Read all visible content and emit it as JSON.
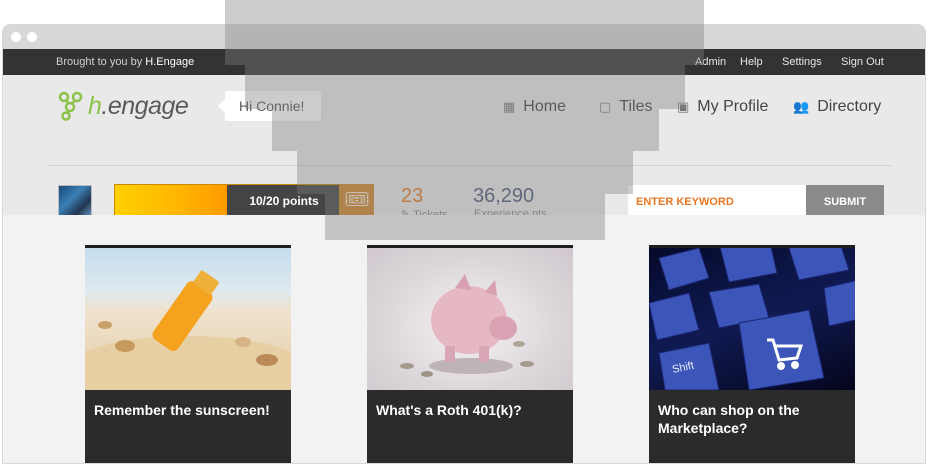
{
  "topbar": {
    "brought_prefix": "Brought to you by ",
    "brought_brand": "H.Engage",
    "links": [
      "Admin",
      "Help",
      "Settings",
      "Sign Out"
    ]
  },
  "header": {
    "logo_text_h": "h",
    "logo_text_rest": ".engage",
    "greeting": "Hi Connie!",
    "nav": [
      {
        "label": "Home",
        "icon": "grid-icon"
      },
      {
        "label": "Tiles",
        "icon": "tiles-icon"
      },
      {
        "label": "My Profile",
        "icon": "profile-card-icon"
      },
      {
        "label": "Directory",
        "icon": "people-icon"
      }
    ]
  },
  "stats": {
    "progress_label": "10/20 points",
    "progress_fraction": 0.5,
    "tickets_value": "23",
    "tickets_label": "Tickets",
    "experience_value": "36,290",
    "experience_label": "Experience pts"
  },
  "search": {
    "placeholder": "ENTER KEYWORD",
    "submit_label": "SUBMIT"
  },
  "cards": [
    {
      "title": "Remember the sunscreen!"
    },
    {
      "title": "What's a Roth 401(k)?"
    },
    {
      "title": "Who can shop on the Marketplace?"
    }
  ],
  "colors": {
    "topbar_bg": "#333333",
    "logo_green": "#8bc34a",
    "accent_orange": "#e87722",
    "progress_yellow": "#ffd000"
  }
}
